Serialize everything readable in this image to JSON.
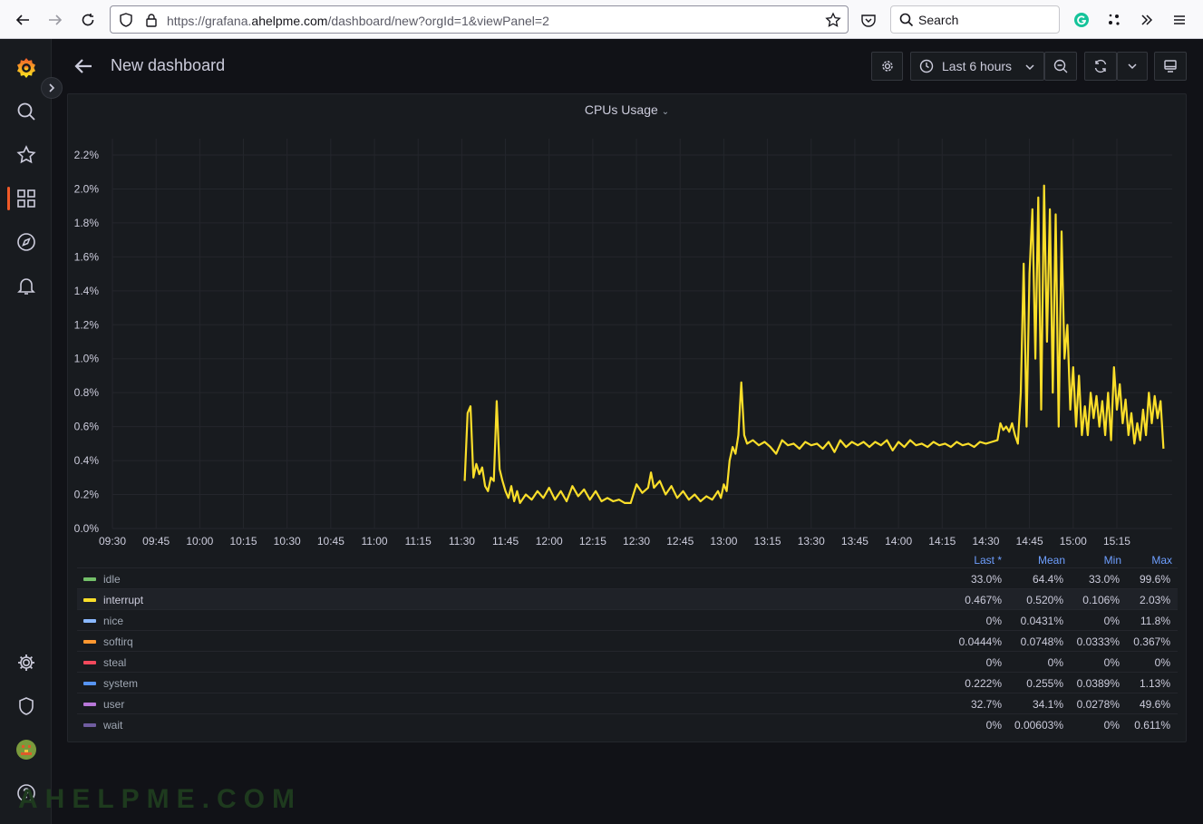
{
  "browser": {
    "url_prefix": "https://grafana.",
    "url_domain": "ahelpme.com",
    "url_suffix": "/dashboard/new?orgId=1&viewPanel=2",
    "search_label": "Search"
  },
  "header": {
    "title": "New dashboard",
    "time_range": "Last 6 hours"
  },
  "panel": {
    "title": "CPUs Usage"
  },
  "legend": {
    "columns": [
      "Last *",
      "Mean",
      "Min",
      "Max"
    ],
    "rows": [
      {
        "name": "idle",
        "color": "#73bf69",
        "last": "33.0%",
        "mean": "64.4%",
        "min": "33.0%",
        "max": "99.6%"
      },
      {
        "name": "interrupt",
        "color": "#fade2a",
        "last": "0.467%",
        "mean": "0.520%",
        "min": "0.106%",
        "max": "2.03%"
      },
      {
        "name": "nice",
        "color": "#8ab8ff",
        "last": "0%",
        "mean": "0.0431%",
        "min": "0%",
        "max": "11.8%"
      },
      {
        "name": "softirq",
        "color": "#ff9830",
        "last": "0.0444%",
        "mean": "0.0748%",
        "min": "0.0333%",
        "max": "0.367%"
      },
      {
        "name": "steal",
        "color": "#f2495c",
        "last": "0%",
        "mean": "0%",
        "min": "0%",
        "max": "0%"
      },
      {
        "name": "system",
        "color": "#5794f2",
        "last": "0.222%",
        "mean": "0.255%",
        "min": "0.0389%",
        "max": "1.13%"
      },
      {
        "name": "user",
        "color": "#b877d9",
        "last": "32.7%",
        "mean": "34.1%",
        "min": "0.0278%",
        "max": "49.6%"
      },
      {
        "name": "wait",
        "color": "#705da0",
        "last": "0%",
        "mean": "0.00603%",
        "min": "0%",
        "max": "0.611%"
      }
    ]
  },
  "chart_data": {
    "type": "line",
    "ylim": [
      0,
      2.3
    ],
    "y_ticks": [
      "0.0%",
      "0.2%",
      "0.4%",
      "0.6%",
      "0.8%",
      "1.0%",
      "1.2%",
      "1.4%",
      "1.6%",
      "1.8%",
      "2.0%",
      "2.2%"
    ],
    "x_ticks": [
      "09:30",
      "09:45",
      "10:00",
      "10:15",
      "10:30",
      "10:45",
      "11:00",
      "11:15",
      "11:30",
      "11:45",
      "12:00",
      "12:15",
      "12:30",
      "12:45",
      "13:00",
      "13:15",
      "13:30",
      "13:45",
      "14:00",
      "14:15",
      "14:30",
      "14:45",
      "15:00",
      "15:15"
    ],
    "x_start_minutes": 570,
    "x_end_minutes": 934,
    "grid": true,
    "series": [
      {
        "name": "interrupt",
        "color": "#fade2a",
        "points": [
          [
            691,
            0.28
          ],
          [
            692,
            0.68
          ],
          [
            693,
            0.72
          ],
          [
            694,
            0.3
          ],
          [
            695,
            0.38
          ],
          [
            696,
            0.32
          ],
          [
            697,
            0.36
          ],
          [
            698,
            0.25
          ],
          [
            699,
            0.22
          ],
          [
            700,
            0.3
          ],
          [
            701,
            0.28
          ],
          [
            702,
            0.75
          ],
          [
            703,
            0.35
          ],
          [
            704,
            0.28
          ],
          [
            705,
            0.22
          ],
          [
            706,
            0.18
          ],
          [
            707,
            0.25
          ],
          [
            708,
            0.16
          ],
          [
            709,
            0.22
          ],
          [
            710,
            0.15
          ],
          [
            712,
            0.2
          ],
          [
            714,
            0.17
          ],
          [
            716,
            0.22
          ],
          [
            718,
            0.18
          ],
          [
            720,
            0.24
          ],
          [
            722,
            0.17
          ],
          [
            724,
            0.22
          ],
          [
            726,
            0.16
          ],
          [
            728,
            0.25
          ],
          [
            730,
            0.19
          ],
          [
            732,
            0.23
          ],
          [
            734,
            0.17
          ],
          [
            736,
            0.22
          ],
          [
            738,
            0.16
          ],
          [
            740,
            0.18
          ],
          [
            742,
            0.16
          ],
          [
            744,
            0.17
          ],
          [
            746,
            0.15
          ],
          [
            748,
            0.15
          ],
          [
            750,
            0.26
          ],
          [
            752,
            0.21
          ],
          [
            754,
            0.24
          ],
          [
            755,
            0.33
          ],
          [
            756,
            0.24
          ],
          [
            758,
            0.28
          ],
          [
            760,
            0.2
          ],
          [
            762,
            0.25
          ],
          [
            764,
            0.18
          ],
          [
            766,
            0.22
          ],
          [
            768,
            0.17
          ],
          [
            770,
            0.2
          ],
          [
            772,
            0.16
          ],
          [
            774,
            0.19
          ],
          [
            776,
            0.17
          ],
          [
            778,
            0.22
          ],
          [
            779,
            0.18
          ],
          [
            780,
            0.26
          ],
          [
            781,
            0.22
          ],
          [
            782,
            0.4
          ],
          [
            783,
            0.48
          ],
          [
            784,
            0.44
          ],
          [
            785,
            0.55
          ],
          [
            786,
            0.86
          ],
          [
            787,
            0.55
          ],
          [
            788,
            0.5
          ],
          [
            790,
            0.52
          ],
          [
            792,
            0.49
          ],
          [
            794,
            0.51
          ],
          [
            796,
            0.48
          ],
          [
            798,
            0.44
          ],
          [
            800,
            0.52
          ],
          [
            802,
            0.49
          ],
          [
            804,
            0.5
          ],
          [
            806,
            0.47
          ],
          [
            808,
            0.51
          ],
          [
            810,
            0.49
          ],
          [
            812,
            0.5
          ],
          [
            814,
            0.47
          ],
          [
            816,
            0.51
          ],
          [
            818,
            0.45
          ],
          [
            820,
            0.52
          ],
          [
            822,
            0.48
          ],
          [
            824,
            0.51
          ],
          [
            826,
            0.49
          ],
          [
            828,
            0.51
          ],
          [
            830,
            0.48
          ],
          [
            832,
            0.51
          ],
          [
            834,
            0.49
          ],
          [
            836,
            0.52
          ],
          [
            838,
            0.46
          ],
          [
            840,
            0.51
          ],
          [
            842,
            0.48
          ],
          [
            844,
            0.52
          ],
          [
            846,
            0.49
          ],
          [
            848,
            0.5
          ],
          [
            850,
            0.48
          ],
          [
            852,
            0.51
          ],
          [
            854,
            0.49
          ],
          [
            856,
            0.5
          ],
          [
            858,
            0.48
          ],
          [
            860,
            0.51
          ],
          [
            862,
            0.49
          ],
          [
            864,
            0.5
          ],
          [
            866,
            0.48
          ],
          [
            868,
            0.51
          ],
          [
            870,
            0.5
          ],
          [
            872,
            0.51
          ],
          [
            874,
            0.52
          ],
          [
            875,
            0.62
          ],
          [
            876,
            0.58
          ],
          [
            877,
            0.6
          ],
          [
            878,
            0.57
          ],
          [
            879,
            0.62
          ],
          [
            880,
            0.55
          ],
          [
            881,
            0.5
          ],
          [
            882,
            0.8
          ],
          [
            883,
            1.56
          ],
          [
            884,
            0.6
          ],
          [
            885,
            1.5
          ],
          [
            886,
            1.88
          ],
          [
            887,
            1.0
          ],
          [
            888,
            1.95
          ],
          [
            889,
            0.7
          ],
          [
            890,
            2.02
          ],
          [
            891,
            1.1
          ],
          [
            892,
            1.88
          ],
          [
            893,
            0.8
          ],
          [
            894,
            1.85
          ],
          [
            895,
            0.6
          ],
          [
            896,
            1.75
          ],
          [
            897,
            1.0
          ],
          [
            898,
            1.2
          ],
          [
            899,
            0.7
          ],
          [
            900,
            0.95
          ],
          [
            901,
            0.6
          ],
          [
            902,
            0.9
          ],
          [
            903,
            0.55
          ],
          [
            904,
            0.72
          ],
          [
            905,
            0.55
          ],
          [
            906,
            0.8
          ],
          [
            907,
            0.65
          ],
          [
            908,
            0.78
          ],
          [
            909,
            0.6
          ],
          [
            910,
            0.75
          ],
          [
            911,
            0.55
          ],
          [
            912,
            0.8
          ],
          [
            913,
            0.52
          ],
          [
            914,
            0.95
          ],
          [
            915,
            0.7
          ],
          [
            916,
            0.85
          ],
          [
            917,
            0.62
          ],
          [
            918,
            0.76
          ],
          [
            919,
            0.55
          ],
          [
            920,
            0.68
          ],
          [
            921,
            0.5
          ],
          [
            922,
            0.62
          ],
          [
            923,
            0.52
          ],
          [
            924,
            0.7
          ],
          [
            925,
            0.55
          ],
          [
            926,
            0.8
          ],
          [
            927,
            0.62
          ],
          [
            928,
            0.78
          ],
          [
            929,
            0.65
          ],
          [
            930,
            0.75
          ],
          [
            931,
            0.47
          ]
        ]
      }
    ]
  }
}
